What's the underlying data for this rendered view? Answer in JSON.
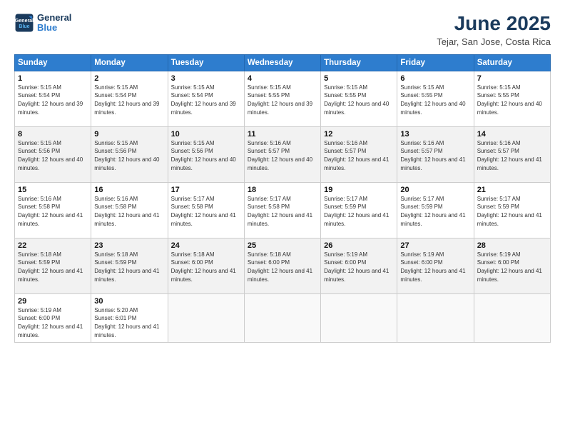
{
  "header": {
    "logo_line1": "General",
    "logo_line2": "Blue",
    "month_year": "June 2025",
    "location": "Tejar, San Jose, Costa Rica"
  },
  "days_of_week": [
    "Sunday",
    "Monday",
    "Tuesday",
    "Wednesday",
    "Thursday",
    "Friday",
    "Saturday"
  ],
  "weeks": [
    [
      {
        "day": "1",
        "sunrise": "5:15 AM",
        "sunset": "5:54 PM",
        "daylight": "12 hours and 39 minutes."
      },
      {
        "day": "2",
        "sunrise": "5:15 AM",
        "sunset": "5:54 PM",
        "daylight": "12 hours and 39 minutes."
      },
      {
        "day": "3",
        "sunrise": "5:15 AM",
        "sunset": "5:54 PM",
        "daylight": "12 hours and 39 minutes."
      },
      {
        "day": "4",
        "sunrise": "5:15 AM",
        "sunset": "5:55 PM",
        "daylight": "12 hours and 39 minutes."
      },
      {
        "day": "5",
        "sunrise": "5:15 AM",
        "sunset": "5:55 PM",
        "daylight": "12 hours and 40 minutes."
      },
      {
        "day": "6",
        "sunrise": "5:15 AM",
        "sunset": "5:55 PM",
        "daylight": "12 hours and 40 minutes."
      },
      {
        "day": "7",
        "sunrise": "5:15 AM",
        "sunset": "5:55 PM",
        "daylight": "12 hours and 40 minutes."
      }
    ],
    [
      {
        "day": "8",
        "sunrise": "5:15 AM",
        "sunset": "5:56 PM",
        "daylight": "12 hours and 40 minutes."
      },
      {
        "day": "9",
        "sunrise": "5:15 AM",
        "sunset": "5:56 PM",
        "daylight": "12 hours and 40 minutes."
      },
      {
        "day": "10",
        "sunrise": "5:15 AM",
        "sunset": "5:56 PM",
        "daylight": "12 hours and 40 minutes."
      },
      {
        "day": "11",
        "sunrise": "5:16 AM",
        "sunset": "5:57 PM",
        "daylight": "12 hours and 40 minutes."
      },
      {
        "day": "12",
        "sunrise": "5:16 AM",
        "sunset": "5:57 PM",
        "daylight": "12 hours and 41 minutes."
      },
      {
        "day": "13",
        "sunrise": "5:16 AM",
        "sunset": "5:57 PM",
        "daylight": "12 hours and 41 minutes."
      },
      {
        "day": "14",
        "sunrise": "5:16 AM",
        "sunset": "5:57 PM",
        "daylight": "12 hours and 41 minutes."
      }
    ],
    [
      {
        "day": "15",
        "sunrise": "5:16 AM",
        "sunset": "5:58 PM",
        "daylight": "12 hours and 41 minutes."
      },
      {
        "day": "16",
        "sunrise": "5:16 AM",
        "sunset": "5:58 PM",
        "daylight": "12 hours and 41 minutes."
      },
      {
        "day": "17",
        "sunrise": "5:17 AM",
        "sunset": "5:58 PM",
        "daylight": "12 hours and 41 minutes."
      },
      {
        "day": "18",
        "sunrise": "5:17 AM",
        "sunset": "5:58 PM",
        "daylight": "12 hours and 41 minutes."
      },
      {
        "day": "19",
        "sunrise": "5:17 AM",
        "sunset": "5:59 PM",
        "daylight": "12 hours and 41 minutes."
      },
      {
        "day": "20",
        "sunrise": "5:17 AM",
        "sunset": "5:59 PM",
        "daylight": "12 hours and 41 minutes."
      },
      {
        "day": "21",
        "sunrise": "5:17 AM",
        "sunset": "5:59 PM",
        "daylight": "12 hours and 41 minutes."
      }
    ],
    [
      {
        "day": "22",
        "sunrise": "5:18 AM",
        "sunset": "5:59 PM",
        "daylight": "12 hours and 41 minutes."
      },
      {
        "day": "23",
        "sunrise": "5:18 AM",
        "sunset": "5:59 PM",
        "daylight": "12 hours and 41 minutes."
      },
      {
        "day": "24",
        "sunrise": "5:18 AM",
        "sunset": "6:00 PM",
        "daylight": "12 hours and 41 minutes."
      },
      {
        "day": "25",
        "sunrise": "5:18 AM",
        "sunset": "6:00 PM",
        "daylight": "12 hours and 41 minutes."
      },
      {
        "day": "26",
        "sunrise": "5:19 AM",
        "sunset": "6:00 PM",
        "daylight": "12 hours and 41 minutes."
      },
      {
        "day": "27",
        "sunrise": "5:19 AM",
        "sunset": "6:00 PM",
        "daylight": "12 hours and 41 minutes."
      },
      {
        "day": "28",
        "sunrise": "5:19 AM",
        "sunset": "6:00 PM",
        "daylight": "12 hours and 41 minutes."
      }
    ],
    [
      {
        "day": "29",
        "sunrise": "5:19 AM",
        "sunset": "6:00 PM",
        "daylight": "12 hours and 41 minutes."
      },
      {
        "day": "30",
        "sunrise": "5:20 AM",
        "sunset": "6:01 PM",
        "daylight": "12 hours and 41 minutes."
      },
      null,
      null,
      null,
      null,
      null
    ]
  ],
  "labels": {
    "sunrise": "Sunrise:",
    "sunset": "Sunset:",
    "daylight": "Daylight:"
  }
}
